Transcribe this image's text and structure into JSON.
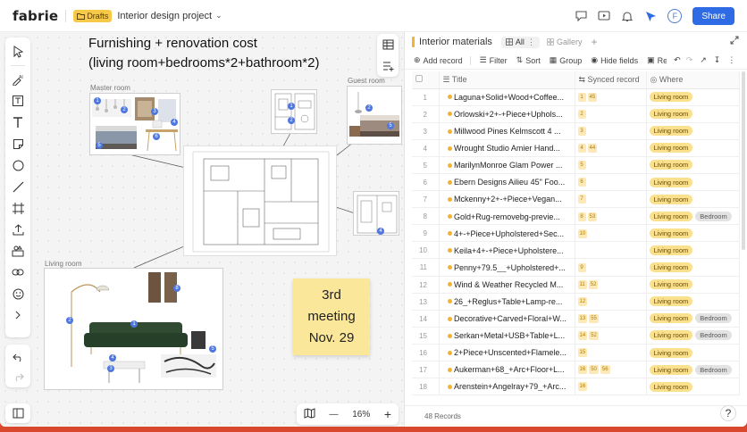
{
  "topbar": {
    "logo": "fabrie",
    "badge": "Drafts",
    "project": "Interior design project",
    "share": "Share",
    "avatar": "F"
  },
  "canvas": {
    "title_line1": "Furnishing + renovation cost",
    "title_line2": "(living room+bedrooms*2+bathroom*2)",
    "frames": {
      "master": "Master room",
      "guest": "Guest room",
      "living": "Living room"
    },
    "sticky": {
      "line1": "3rd",
      "line2": "meeting",
      "line3": "Nov. 29"
    },
    "zoom": "16%"
  },
  "panel": {
    "title": "Interior materials",
    "view_all": "All",
    "view_gallery": "Gallery",
    "toolbar": {
      "add": "Add record",
      "filter": "Filter",
      "sort": "Sort",
      "group": "Group",
      "hide": "Hide fields",
      "refs": "Refs"
    },
    "columns": {
      "title": "Title",
      "synced": "Synced record",
      "where": "Where"
    },
    "footer": "48 Records",
    "rows": [
      {
        "n": "1",
        "title": "Laguna+Solid+Wood+Coffee...",
        "sync": [
          "1",
          "45"
        ],
        "tags": [
          "Living room"
        ]
      },
      {
        "n": "2",
        "title": "Orlowski+2+-+Piece+Uphols...",
        "sync": [
          "2"
        ],
        "tags": [
          "Living room"
        ]
      },
      {
        "n": "3",
        "title": "Millwood Pines Kelmscott 4 ...",
        "sync": [
          "3"
        ],
        "tags": [
          "Living room"
        ]
      },
      {
        "n": "4",
        "title": "Wrought Studio Amier Hand...",
        "sync": [
          "4",
          "44"
        ],
        "tags": [
          "Living room"
        ]
      },
      {
        "n": "5",
        "title": "MarilynMonroe Glam Power ...",
        "sync": [
          "5"
        ],
        "tags": [
          "Living room"
        ]
      },
      {
        "n": "6",
        "title": "Ebern Designs Ailieu 45\" Foo...",
        "sync": [
          "6"
        ],
        "tags": [
          "Living room"
        ]
      },
      {
        "n": "7",
        "title": "Mckenny+2+-+Piece+Vegan...",
        "sync": [
          "7"
        ],
        "tags": [
          "Living room"
        ]
      },
      {
        "n": "8",
        "title": "Gold+Rug-removebg-previe...",
        "sync": [
          "8",
          "53"
        ],
        "tags": [
          "Living room",
          "Bedroom"
        ]
      },
      {
        "n": "9",
        "title": "4+-+Piece+Upholstered+Sec...",
        "sync": [
          "10"
        ],
        "tags": [
          "Living room"
        ]
      },
      {
        "n": "10",
        "title": "Keila+4+-+Piece+Upholstere...",
        "sync": [],
        "tags": [
          "Living room"
        ]
      },
      {
        "n": "11",
        "title": "Penny+79.5__+Upholstered+...",
        "sync": [
          "9"
        ],
        "tags": [
          "Living room"
        ]
      },
      {
        "n": "12",
        "title": "Wind & Weather Recycled M...",
        "sync": [
          "11",
          "52"
        ],
        "tags": [
          "Living room"
        ]
      },
      {
        "n": "13",
        "title": "26_+Reglus+Table+Lamp-re...",
        "sync": [
          "12"
        ],
        "tags": [
          "Living room"
        ]
      },
      {
        "n": "14",
        "title": "Decorative+Carved+Floral+W...",
        "sync": [
          "13",
          "55"
        ],
        "tags": [
          "Living room",
          "Bedroom"
        ]
      },
      {
        "n": "15",
        "title": "Serkan+Metal+USB+Table+L...",
        "sync": [
          "14",
          "52"
        ],
        "tags": [
          "Living room",
          "Bedroom"
        ]
      },
      {
        "n": "16",
        "title": "2+Piece+Unscented+Flamele...",
        "sync": [
          "15"
        ],
        "tags": [
          "Living room"
        ]
      },
      {
        "n": "17",
        "title": "Aukerman+68_+Arc+Floor+L...",
        "sync": [
          "16",
          "50",
          "56"
        ],
        "tags": [
          "Living room",
          "Bedroom"
        ]
      },
      {
        "n": "18",
        "title": "Arenstein+Angelray+79_+Arc...",
        "sync": [
          "16"
        ],
        "tags": [
          "Living room"
        ]
      }
    ]
  }
}
